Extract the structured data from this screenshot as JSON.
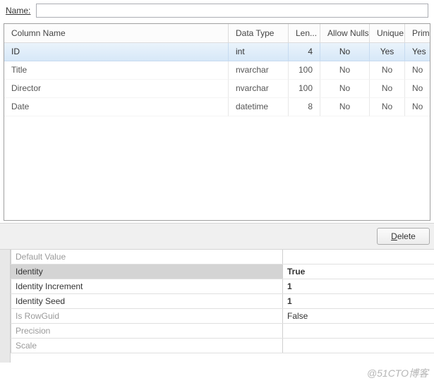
{
  "labels": {
    "name": "Name:",
    "deleteBtnPrefix": "",
    "deleteBtnHot": "D",
    "deleteBtnRest": "elete"
  },
  "nameValue": "",
  "headers": {
    "columnName": "Column Name",
    "dataType": "Data Type",
    "length": "Len...",
    "allowNulls": "Allow Nulls",
    "unique": "Unique",
    "primaryKey": "Primary Key"
  },
  "columns": [
    {
      "name": "ID",
      "dataType": "int",
      "length": "4",
      "allowNulls": "No",
      "unique": "Yes",
      "primaryKey": "Yes",
      "selected": true
    },
    {
      "name": "Title",
      "dataType": "nvarchar",
      "length": "100",
      "allowNulls": "No",
      "unique": "No",
      "primaryKey": "No",
      "selected": false
    },
    {
      "name": "Director",
      "dataType": "nvarchar",
      "length": "100",
      "allowNulls": "No",
      "unique": "No",
      "primaryKey": "No",
      "selected": false
    },
    {
      "name": "Date",
      "dataType": "datetime",
      "length": "8",
      "allowNulls": "No",
      "unique": "No",
      "primaryKey": "No",
      "selected": false
    }
  ],
  "properties": [
    {
      "label": "Default Value",
      "value": "",
      "disabled": true,
      "bold": false,
      "selected": false
    },
    {
      "label": "Identity",
      "value": "True",
      "disabled": false,
      "bold": true,
      "selected": true
    },
    {
      "label": "Identity Increment",
      "value": "1",
      "disabled": false,
      "bold": true,
      "selected": false
    },
    {
      "label": "Identity Seed",
      "value": "1",
      "disabled": false,
      "bold": true,
      "selected": false
    },
    {
      "label": "Is RowGuid",
      "value": "False",
      "disabled": true,
      "bold": false,
      "selected": false
    },
    {
      "label": "Precision",
      "value": "",
      "disabled": true,
      "bold": false,
      "selected": false
    },
    {
      "label": "Scale",
      "value": "",
      "disabled": true,
      "bold": false,
      "selected": false
    }
  ],
  "watermark": "@51CTO博客"
}
